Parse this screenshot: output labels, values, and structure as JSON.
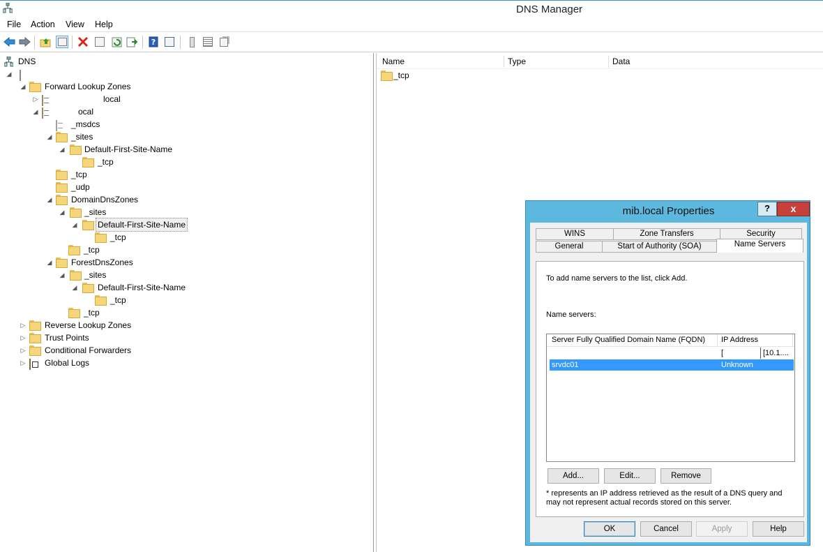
{
  "window": {
    "title": "DNS Manager"
  },
  "menu": {
    "file": "File",
    "action": "Action",
    "view": "View",
    "help": "Help"
  },
  "toolbar": {
    "icons": [
      "back-icon",
      "forward-icon",
      "up-folder-icon",
      "show-hide-tree-icon",
      "delete-icon",
      "properties-icon",
      "refresh-icon",
      "export-list-icon",
      "help-icon",
      "console-icon",
      "server-icon",
      "list-icon",
      "copy-icon"
    ]
  },
  "tree": {
    "dns": "DNS",
    "forward_lookup_zones": "Forward Lookup Zones",
    "zone1": "local",
    "zone2": "ocal",
    "msdcs": "_msdcs",
    "sites": "_sites",
    "default_first_site": "Default-First-Site-Name",
    "tcp": "_tcp",
    "udp": "_udp",
    "domain_dns_zones": "DomainDnsZones",
    "forest_dns_zones": "ForestDnsZones",
    "reverse_lookup_zones": "Reverse Lookup Zones",
    "trust_points": "Trust Points",
    "conditional_forwarders": "Conditional Forwarders",
    "global_logs": "Global Logs"
  },
  "list": {
    "columns": [
      "Name",
      "Type",
      "Data"
    ],
    "items": [
      {
        "name": "_tcp"
      }
    ]
  },
  "dialog": {
    "title": "mib.local Properties",
    "help_label": "?",
    "close_label": "x",
    "tabs_row1": [
      "WINS",
      "Zone Transfers",
      "Security"
    ],
    "tabs_row2": [
      "General",
      "Start of Authority (SOA)",
      "Name Servers"
    ],
    "instruction": "To add name servers to the list, click Add.",
    "list_label": "Name servers:",
    "columns": [
      "Server Fully Qualified Domain Name (FQDN)",
      "IP Address"
    ],
    "rows": [
      {
        "fqdn": "",
        "ip": "[",
        "ip2": "[10.1...."
      },
      {
        "fqdn": "srvdc01",
        "ip": "Unknown"
      }
    ],
    "add": "Add...",
    "edit": "Edit...",
    "remove": "Remove",
    "note": "* represents an IP address retrieved as the result of a DNS query and may not represent actual records stored on this server.",
    "ok": "OK",
    "cancel": "Cancel",
    "apply": "Apply",
    "help": "Help"
  },
  "colors": {
    "dialog_frame": "#5cb8de",
    "selection": "#3399ff",
    "close_button": "#c7413a"
  }
}
